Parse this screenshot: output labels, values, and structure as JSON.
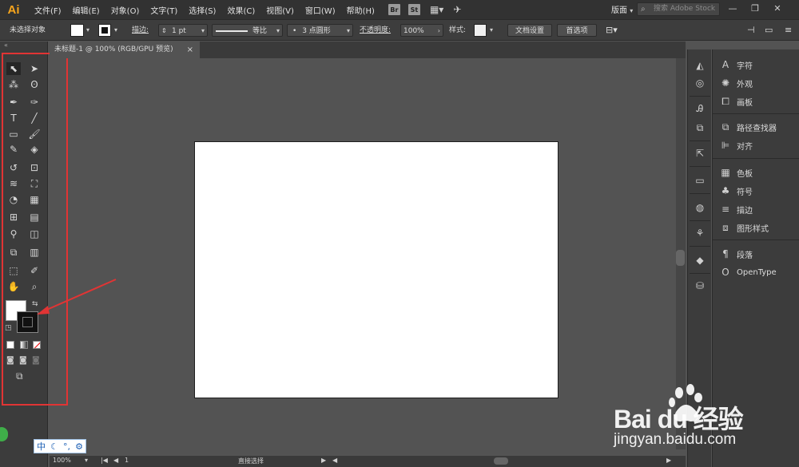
{
  "app": {
    "logo": "Ai"
  },
  "menu": [
    "文件(F)",
    "编辑(E)",
    "对象(O)",
    "文字(T)",
    "选择(S)",
    "效果(C)",
    "视图(V)",
    "窗口(W)",
    "帮助(H)"
  ],
  "app_buttons": [
    "Br",
    "St"
  ],
  "workspace": {
    "label": "版面"
  },
  "search": {
    "placeholder": "搜索 Adobe Stock"
  },
  "control_bar": {
    "selection_status": "未选择对象",
    "stroke_label": "描边:",
    "stroke_value": "1 pt",
    "profile_label": "等比",
    "brush_label": "3 点圆形",
    "opacity_label": "不透明度:",
    "opacity_value": "100%",
    "style_label": "样式:",
    "doc_setup_button": "文档设置",
    "preferences_button": "首选项"
  },
  "document_tab": {
    "title": "未标题-1 @ 100% (RGB/GPU 预览)",
    "close": "×"
  },
  "status_bar": {
    "zoom": "100%",
    "artboard": "1",
    "tool_status": "直接选择"
  },
  "right_panels": [
    {
      "icon": "character-icon",
      "label": "字符"
    },
    {
      "icon": "appearance-icon",
      "label": "外观"
    },
    {
      "icon": "artboards-icon",
      "label": "画板"
    },
    {
      "icon": "pathfinder-icon",
      "label": "路径查找器"
    },
    {
      "icon": "align-icon",
      "label": "对齐"
    },
    {
      "icon": "swatches-icon",
      "label": "色板"
    },
    {
      "icon": "symbols-icon",
      "label": "符号"
    },
    {
      "icon": "stroke-icon",
      "label": "描边"
    },
    {
      "icon": "graphic-styles-icon",
      "label": "图形样式"
    },
    {
      "icon": "paragraph-icon",
      "label": "段落"
    },
    {
      "icon": "opentype-icon",
      "label": "OpenType"
    }
  ],
  "ime": {
    "lang": "中"
  },
  "watermark": {
    "brand_logo_text": "Bai du 经验",
    "url": "jingyan.baidu.com"
  },
  "colors": {
    "accent_logo": "#f7a51c",
    "highlight_box": "#e13434",
    "canvas_bg": "#535353",
    "panel_bg": "#3c3c3c"
  }
}
